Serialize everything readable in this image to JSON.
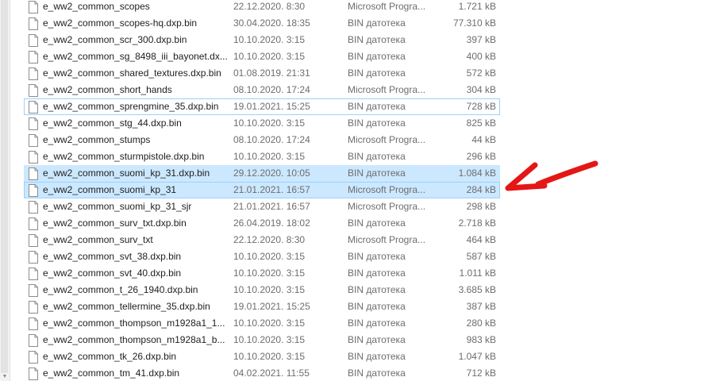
{
  "annotation": {
    "color": "#e51616"
  },
  "files": [
    {
      "name": "e_ww2_common_scopes",
      "date": "22.12.2020. 8:30",
      "type": "Microsoft Progra...",
      "size": "1.721 kB",
      "selected": false,
      "focused": false
    },
    {
      "name": "e_ww2_common_scopes-hq.dxp.bin",
      "date": "30.04.2020. 18:35",
      "type": "BIN датотека",
      "size": "77.310 kB",
      "selected": false,
      "focused": false
    },
    {
      "name": "e_ww2_common_scr_300.dxp.bin",
      "date": "10.10.2020. 3:15",
      "type": "BIN датотека",
      "size": "397 kB",
      "selected": false,
      "focused": false
    },
    {
      "name": "e_ww2_common_sg_8498_iii_bayonet.dx...",
      "date": "10.10.2020. 3:15",
      "type": "BIN датотека",
      "size": "400 kB",
      "selected": false,
      "focused": false
    },
    {
      "name": "e_ww2_common_shared_textures.dxp.bin",
      "date": "01.08.2019. 21:31",
      "type": "BIN датотека",
      "size": "572 kB",
      "selected": false,
      "focused": false
    },
    {
      "name": "e_ww2_common_short_hands",
      "date": "08.10.2020. 17:24",
      "type": "Microsoft Progra...",
      "size": "304 kB",
      "selected": false,
      "focused": false
    },
    {
      "name": "e_ww2_common_sprengmine_35.dxp.bin",
      "date": "19.01.2021. 15:25",
      "type": "BIN датотека",
      "size": "728 kB",
      "selected": false,
      "focused": true
    },
    {
      "name": "e_ww2_common_stg_44.dxp.bin",
      "date": "10.10.2020. 3:15",
      "type": "BIN датотека",
      "size": "825 kB",
      "selected": false,
      "focused": false
    },
    {
      "name": "e_ww2_common_stumps",
      "date": "08.10.2020. 17:24",
      "type": "Microsoft Progra...",
      "size": "44 kB",
      "selected": false,
      "focused": false
    },
    {
      "name": "e_ww2_common_sturmpistole.dxp.bin",
      "date": "10.10.2020. 3:15",
      "type": "BIN датотека",
      "size": "296 kB",
      "selected": false,
      "focused": false
    },
    {
      "name": "e_ww2_common_suomi_kp_31.dxp.bin",
      "date": "29.12.2020. 10:05",
      "type": "BIN датотека",
      "size": "1.084 kB",
      "selected": true,
      "focused": false
    },
    {
      "name": "e_ww2_common_suomi_kp_31",
      "date": "21.01.2021. 16:57",
      "type": "Microsoft Progra...",
      "size": "284 kB",
      "selected": true,
      "focused": true
    },
    {
      "name": "e_ww2_common_suomi_kp_31_sjr",
      "date": "21.01.2021. 16:57",
      "type": "Microsoft Progra...",
      "size": "298 kB",
      "selected": false,
      "focused": false
    },
    {
      "name": "e_ww2_common_surv_txt.dxp.bin",
      "date": "26.04.2019. 18:02",
      "type": "BIN датотека",
      "size": "2.718 kB",
      "selected": false,
      "focused": false
    },
    {
      "name": "e_ww2_common_surv_txt",
      "date": "22.12.2020. 8:30",
      "type": "Microsoft Progra...",
      "size": "464 kB",
      "selected": false,
      "focused": false
    },
    {
      "name": "e_ww2_common_svt_38.dxp.bin",
      "date": "10.10.2020. 3:15",
      "type": "BIN датотека",
      "size": "587 kB",
      "selected": false,
      "focused": false
    },
    {
      "name": "e_ww2_common_svt_40.dxp.bin",
      "date": "10.10.2020. 3:15",
      "type": "BIN датотека",
      "size": "1.011 kB",
      "selected": false,
      "focused": false
    },
    {
      "name": "e_ww2_common_t_26_1940.dxp.bin",
      "date": "10.10.2020. 3:15",
      "type": "BIN датотека",
      "size": "3.685 kB",
      "selected": false,
      "focused": false
    },
    {
      "name": "e_ww2_common_tellermine_35.dxp.bin",
      "date": "19.01.2021. 15:25",
      "type": "BIN датотека",
      "size": "387 kB",
      "selected": false,
      "focused": false
    },
    {
      "name": "e_ww2_common_thompson_m1928a1_1...",
      "date": "10.10.2020. 3:15",
      "type": "BIN датотека",
      "size": "280 kB",
      "selected": false,
      "focused": false
    },
    {
      "name": "e_ww2_common_thompson_m1928a1_b...",
      "date": "10.10.2020. 3:15",
      "type": "BIN датотека",
      "size": "983 kB",
      "selected": false,
      "focused": false
    },
    {
      "name": "e_ww2_common_tk_26.dxp.bin",
      "date": "10.10.2020. 3:15",
      "type": "BIN датотека",
      "size": "1.047 kB",
      "selected": false,
      "focused": false
    },
    {
      "name": "e_ww2_common_tm_41.dxp.bin",
      "date": "04.02.2021. 11:55",
      "type": "BIN датотека",
      "size": "712 kB",
      "selected": false,
      "focused": false
    }
  ]
}
